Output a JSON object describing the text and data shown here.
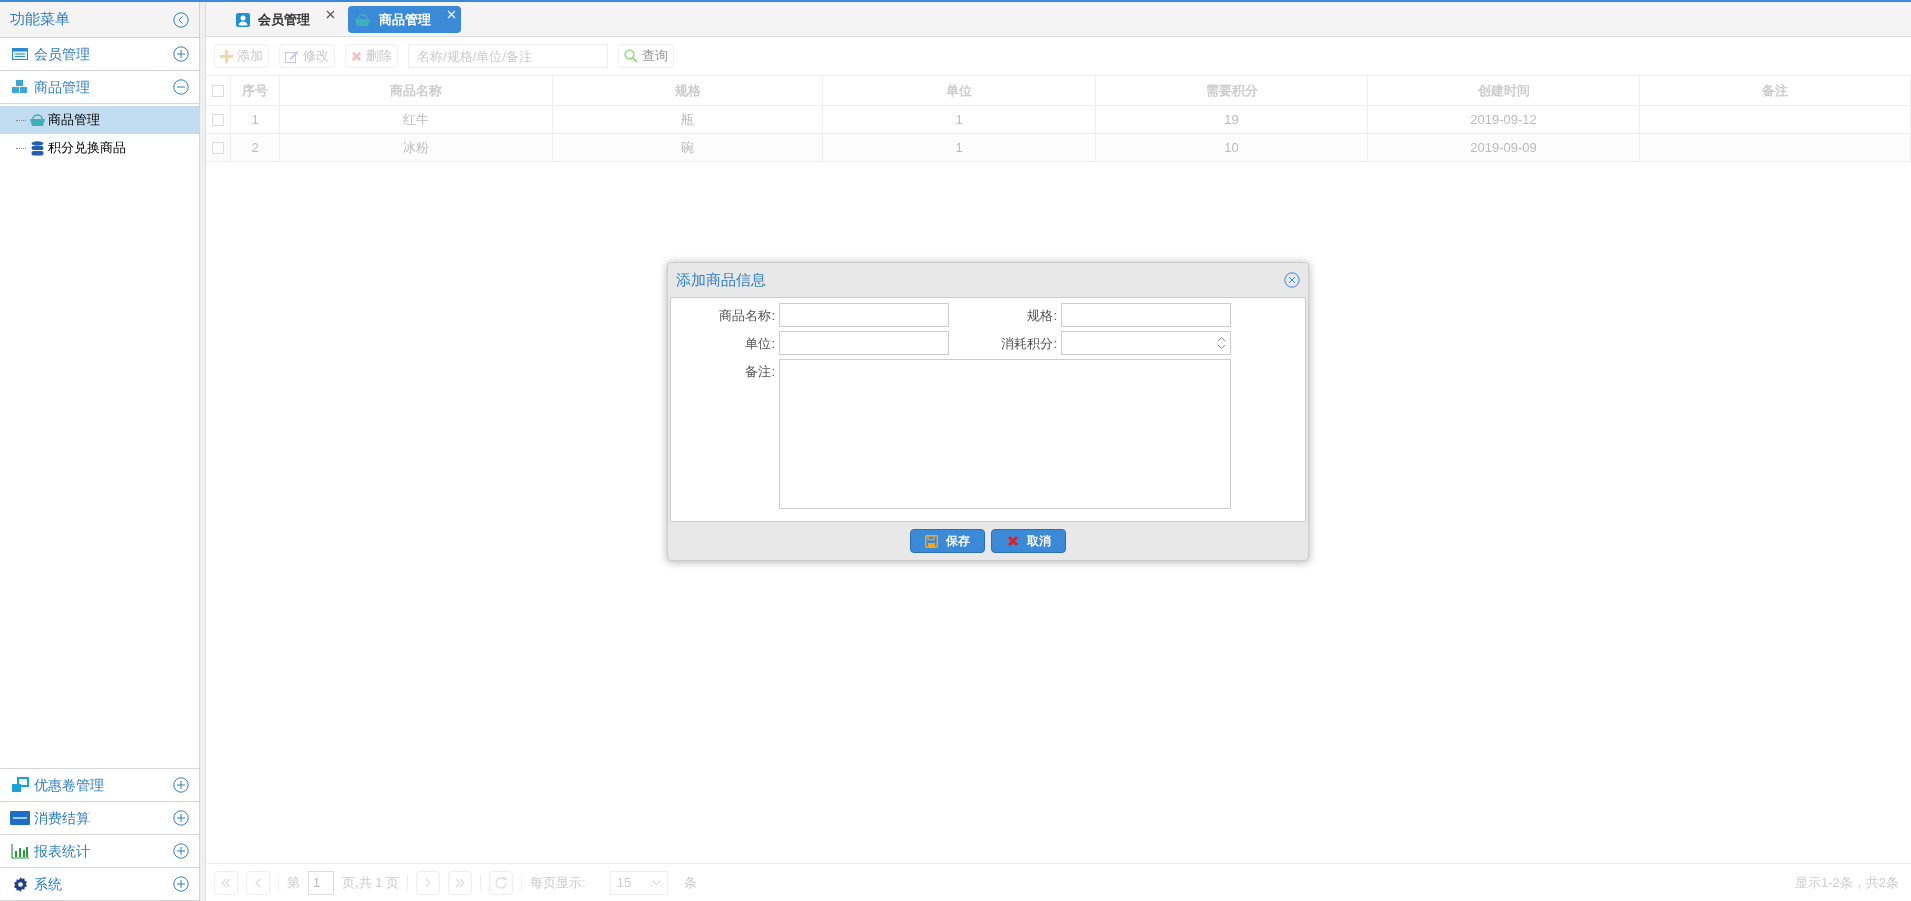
{
  "sidebar": {
    "title": "功能菜单",
    "groups": [
      {
        "label": "会员管理",
        "expanded": false
      },
      {
        "label": "商品管理",
        "expanded": true,
        "children": [
          {
            "label": "商品管理",
            "selected": true
          },
          {
            "label": "积分兑换商品",
            "selected": false
          }
        ]
      }
    ],
    "bottom_groups": [
      {
        "label": "优惠卷管理",
        "expanded": false
      },
      {
        "label": "消费结算",
        "expanded": false
      },
      {
        "label": "报表统计",
        "expanded": false
      },
      {
        "label": "系统",
        "expanded": false
      }
    ]
  },
  "tabs": [
    {
      "label": "会员管理",
      "selected": false
    },
    {
      "label": "商品管理",
      "selected": true
    }
  ],
  "toolbar": {
    "buttons": [
      "添加",
      "修改",
      "删除"
    ],
    "search": {
      "placeholder": "名称/规格/单位/备注"
    },
    "query_button": "查询"
  },
  "table": {
    "select_all": false,
    "columns": [
      "序号",
      "商品名称",
      "规格",
      "单位",
      "需要积分",
      "创建时间",
      "备注"
    ],
    "rows": [
      {
        "checked": false,
        "cells": [
          "1",
          "红牛",
          "瓶",
          "1",
          "19",
          "2019-09-12",
          ""
        ]
      },
      {
        "checked": false,
        "cells": [
          "2",
          "冰粉",
          "碗",
          "1",
          "10",
          "2019-09-09",
          ""
        ]
      }
    ]
  },
  "pager": {
    "page_prefix": "第",
    "page": "1",
    "page_suffix": "页,共 1 页",
    "per_page_label": "每页显示:",
    "per_page": "15",
    "per_page_suffix": "条",
    "summary": "显示1-2条，共2条"
  },
  "dialog": {
    "title": "添加商品信息",
    "fields": [
      {
        "label": "商品名称:",
        "kind": "text"
      },
      {
        "label": "规格:",
        "kind": "text"
      },
      {
        "label": "单位:",
        "kind": "text"
      },
      {
        "label": "消耗积分:",
        "kind": "number"
      },
      {
        "label": "备注:",
        "kind": "textarea"
      }
    ],
    "buttons": [
      "保存",
      "取消"
    ]
  }
}
